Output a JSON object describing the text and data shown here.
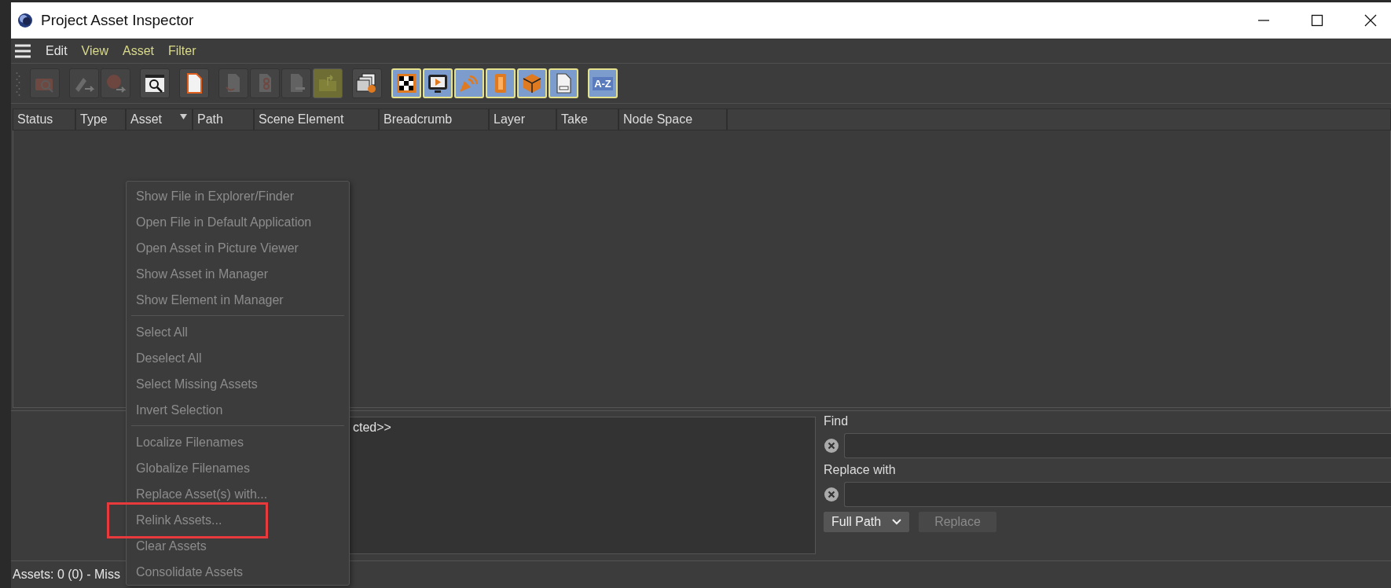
{
  "window": {
    "title": "Project Asset Inspector"
  },
  "menu_bar": [
    {
      "label": "Edit",
      "color": "#e6e6e6"
    },
    {
      "label": "View",
      "color": "#d9d98c"
    },
    {
      "label": "Asset",
      "color": "#d9d98c"
    },
    {
      "label": "Filter",
      "color": "#d9d98c"
    }
  ],
  "toolbar": [
    [
      {
        "kind": "camera",
        "disabled": true,
        "on": false
      }
    ],
    [
      {
        "kind": "export",
        "disabled": true,
        "on": false
      },
      {
        "kind": "record",
        "disabled": true,
        "on": false
      }
    ],
    [
      {
        "kind": "search-doc",
        "disabled": false,
        "on": false
      }
    ],
    [
      {
        "kind": "document",
        "disabled": false,
        "on": false
      }
    ],
    [
      {
        "kind": "doc-arrow",
        "disabled": true,
        "on": false
      },
      {
        "kind": "doc-link",
        "disabled": true,
        "on": false
      },
      {
        "kind": "doc-minus",
        "disabled": true,
        "on": false
      },
      {
        "kind": "folder",
        "disabled": true,
        "on": true
      }
    ],
    [
      {
        "kind": "gallery",
        "disabled": false,
        "on": false
      }
    ],
    [
      {
        "kind": "checker",
        "disabled": false,
        "on": true
      },
      {
        "kind": "play",
        "disabled": false,
        "on": true
      },
      {
        "kind": "speaker",
        "disabled": false,
        "on": true
      },
      {
        "kind": "film",
        "disabled": false,
        "on": true
      },
      {
        "kind": "cube",
        "disabled": false,
        "on": true
      },
      {
        "kind": "file",
        "disabled": false,
        "on": true
      }
    ],
    [
      {
        "kind": "az",
        "label": "A-Z",
        "disabled": false,
        "on": true
      }
    ]
  ],
  "table": {
    "columns": [
      {
        "label": "Status",
        "sorted": false
      },
      {
        "label": "Type",
        "sorted": false
      },
      {
        "label": "Asset",
        "sorted": true
      },
      {
        "label": "Path",
        "sorted": false
      },
      {
        "label": "Scene Element",
        "sorted": false
      },
      {
        "label": "Breadcrumb",
        "sorted": false
      },
      {
        "label": "Layer",
        "sorted": false
      },
      {
        "label": "Take",
        "sorted": false
      },
      {
        "label": "Node Space",
        "sorted": false
      }
    ]
  },
  "details": {
    "text": "cted>>"
  },
  "find_panel": {
    "find_label": "Find",
    "replace_label": "Replace with",
    "mode": "Full Path",
    "replace_button": {
      "label": "Replace",
      "disabled": true
    }
  },
  "status_bar": {
    "text": "Assets: 0 (0) - Miss"
  },
  "context_menu": {
    "items": [
      {
        "kind": "item",
        "label": "Show File in Explorer/Finder",
        "disabled": true,
        "highlighted": false
      },
      {
        "kind": "item",
        "label": "Open File in Default Application",
        "disabled": true,
        "highlighted": false
      },
      {
        "kind": "item",
        "label": "Open Asset in Picture Viewer",
        "disabled": true,
        "highlighted": false
      },
      {
        "kind": "item",
        "label": "Show Asset in Manager",
        "disabled": true,
        "highlighted": false
      },
      {
        "kind": "item",
        "label": "Show Element in Manager",
        "disabled": true,
        "highlighted": false
      },
      {
        "kind": "separator"
      },
      {
        "kind": "item",
        "label": "Select All",
        "disabled": true,
        "highlighted": false
      },
      {
        "kind": "item",
        "label": "Deselect All",
        "disabled": true,
        "highlighted": false
      },
      {
        "kind": "item",
        "label": "Select Missing Assets",
        "disabled": true,
        "highlighted": false
      },
      {
        "kind": "item",
        "label": "Invert Selection",
        "disabled": true,
        "highlighted": false
      },
      {
        "kind": "separator"
      },
      {
        "kind": "item",
        "label": "Localize Filenames",
        "disabled": true,
        "highlighted": false
      },
      {
        "kind": "item",
        "label": "Globalize Filenames",
        "disabled": true,
        "highlighted": false
      },
      {
        "kind": "item",
        "label": "Replace Asset(s) with...",
        "disabled": true,
        "highlighted": false
      },
      {
        "kind": "item",
        "label": "Relink Assets...",
        "disabled": true,
        "highlighted": true
      },
      {
        "kind": "item",
        "label": "Clear Assets",
        "disabled": true,
        "highlighted": false
      },
      {
        "kind": "item",
        "label": "Consolidate Assets",
        "disabled": true,
        "highlighted": false
      }
    ]
  }
}
